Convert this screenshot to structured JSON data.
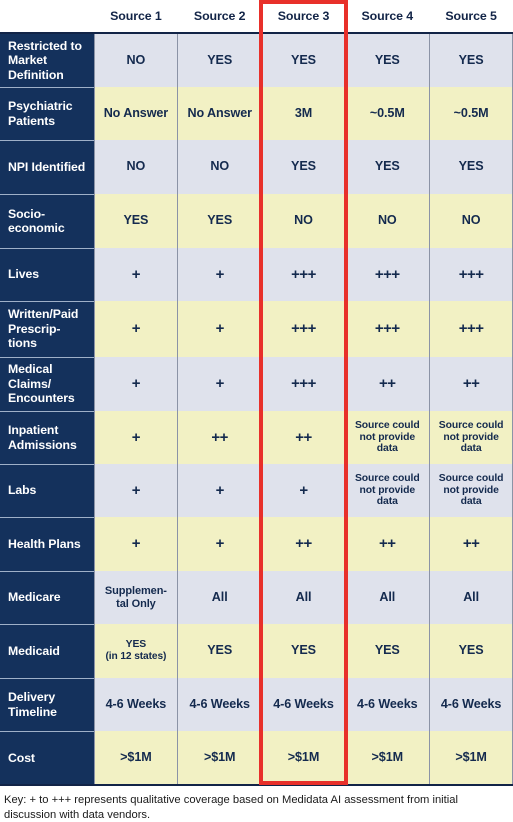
{
  "table": {
    "corner_label": "",
    "columns": [
      "Source 1",
      "Source 2",
      "Source 3",
      "Source 4",
      "Source 5"
    ],
    "highlighted_column": "Source 3",
    "rows": [
      {
        "label": "Restricted to Market Definition",
        "band": "blue",
        "values": [
          "NO",
          "YES",
          "YES",
          "YES",
          "YES"
        ]
      },
      {
        "label": "Psychiatric Patients",
        "band": "yellow",
        "values": [
          "No Answer",
          "No Answer",
          "3M",
          "~0.5M",
          "~0.5M"
        ]
      },
      {
        "label": "NPI Identified",
        "band": "blue",
        "values": [
          "NO",
          "NO",
          "YES",
          "YES",
          "YES"
        ]
      },
      {
        "label": "Socio-economic",
        "band": "yellow",
        "values": [
          "YES",
          "YES",
          "NO",
          "NO",
          "NO"
        ]
      },
      {
        "label": "Lives",
        "band": "blue",
        "values": [
          "+",
          "+",
          "+++",
          "+++",
          "+++"
        ]
      },
      {
        "label": "Written/Paid Prescrip-tions",
        "band": "yellow",
        "values": [
          "+",
          "+",
          "+++",
          "+++",
          "+++"
        ]
      },
      {
        "label": "Medical Claims/ Encounters",
        "band": "blue",
        "values": [
          "+",
          "+",
          "+++",
          "++",
          "++"
        ]
      },
      {
        "label": "Inpatient Admissions",
        "band": "yellow",
        "values": [
          "+",
          "++",
          "++",
          "Source could not provide data",
          "Source could not provide data"
        ]
      },
      {
        "label": "Labs",
        "band": "blue",
        "values": [
          "+",
          "+",
          "+",
          "Source could not provide data",
          "Source could not provide data"
        ]
      },
      {
        "label": "Health Plans",
        "band": "yellow",
        "values": [
          "+",
          "+",
          "++",
          "++",
          "++"
        ]
      },
      {
        "label": "Medicare",
        "band": "blue",
        "values": [
          "Supplemen-tal Only",
          "All",
          "All",
          "All",
          "All"
        ]
      },
      {
        "label": "Medicaid",
        "band": "yellow",
        "values": [
          "YES (in 12 states)",
          "YES",
          "YES",
          "YES",
          "YES"
        ]
      },
      {
        "label": "Delivery Timeline",
        "band": "blue",
        "values": [
          "4-6 Weeks",
          "4-6 Weeks",
          "4-6 Weeks",
          "4-6 Weeks",
          "4-6 Weeks"
        ]
      },
      {
        "label": "Cost",
        "band": "yellow",
        "values": [
          ">$1M",
          ">$1M",
          ">$1M",
          ">$1M",
          ">$1M"
        ]
      }
    ]
  },
  "footer": {
    "key_text": "Key: + to +++ represents qualitative coverage based on Medidata AI assessment from initial discussion with data vendors."
  },
  "colors": {
    "header_navy": "#14315c",
    "band_blue": "#dfe2ec",
    "band_yellow": "#f2f1c4",
    "highlight_red": "#e8302a",
    "text_navy": "#142a4e"
  }
}
